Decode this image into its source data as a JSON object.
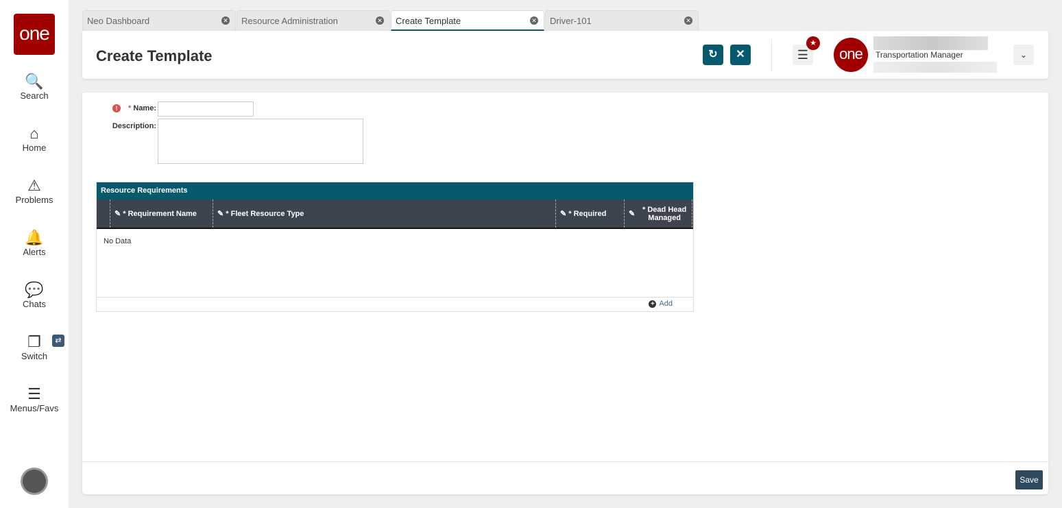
{
  "sidebar": {
    "logo": "one",
    "items": [
      {
        "label": "Search"
      },
      {
        "label": "Home"
      },
      {
        "label": "Problems"
      },
      {
        "label": "Alerts"
      },
      {
        "label": "Chats"
      },
      {
        "label": "Switch"
      },
      {
        "label": "Menus/Favs"
      }
    ]
  },
  "tabs": [
    {
      "label": "Neo Dashboard"
    },
    {
      "label": "Resource Administration"
    },
    {
      "label": "Create Template"
    },
    {
      "label": "Driver-101"
    }
  ],
  "header": {
    "title": "Create Template",
    "role": "Transportation Manager",
    "user_logo": "one"
  },
  "form": {
    "name_label": "* Name:",
    "name_value": "",
    "description_label": "Description:",
    "description_value": ""
  },
  "grid": {
    "title": "Resource Requirements",
    "columns": [
      "* Requirement Name",
      "* Fleet Resource Type",
      "* Required",
      "* Dead Head Managed"
    ],
    "empty": "No Data",
    "add_label": "Add"
  },
  "footer": {
    "save_label": "Save"
  },
  "colors": {
    "accent": "#075a6d",
    "brand": "#a00000"
  }
}
